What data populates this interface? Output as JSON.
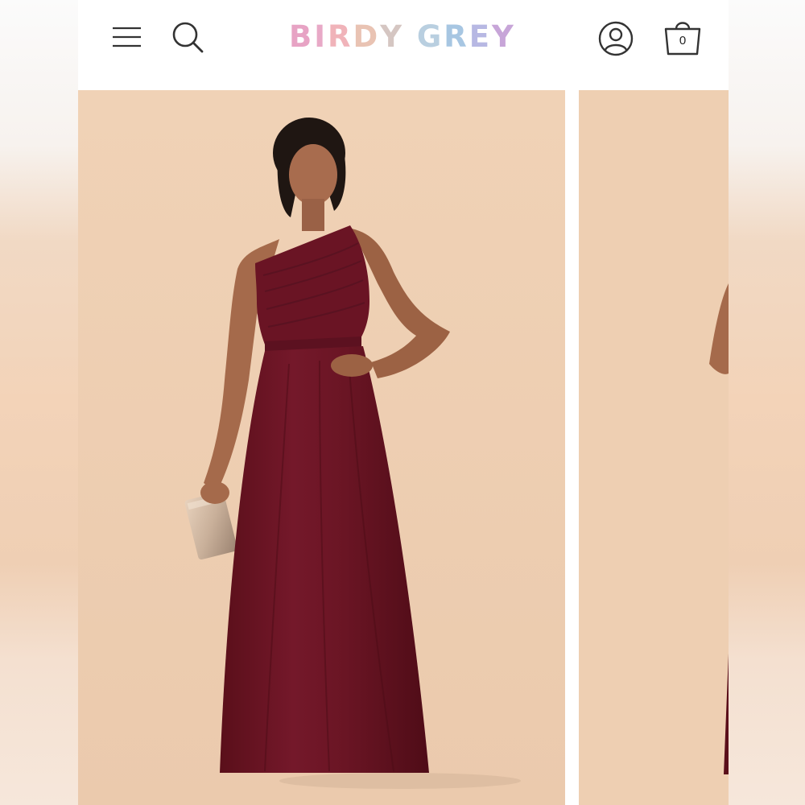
{
  "header": {
    "brand": [
      "B",
      "I",
      "R",
      "D",
      "Y",
      " ",
      "G",
      "R",
      "E",
      "Y"
    ],
    "brand_colors": [
      "#e7a3c4",
      "#e8a9c7",
      "#f0b3b9",
      "#e9c3b3",
      "#d5c6c2",
      "#ffffff",
      "#b9cfe0",
      "#a7c6e2",
      "#b7b8e3",
      "#c7a5d8"
    ],
    "cart_count": "0",
    "icons": {
      "menu": "hamburger-menu-icon",
      "search": "search-icon",
      "account": "user-account-icon",
      "cart": "shopping-bag-icon"
    }
  },
  "gallery": {
    "background_color": "#eecfb2",
    "dress_color": "#6b1521",
    "slides_visible": 2
  }
}
